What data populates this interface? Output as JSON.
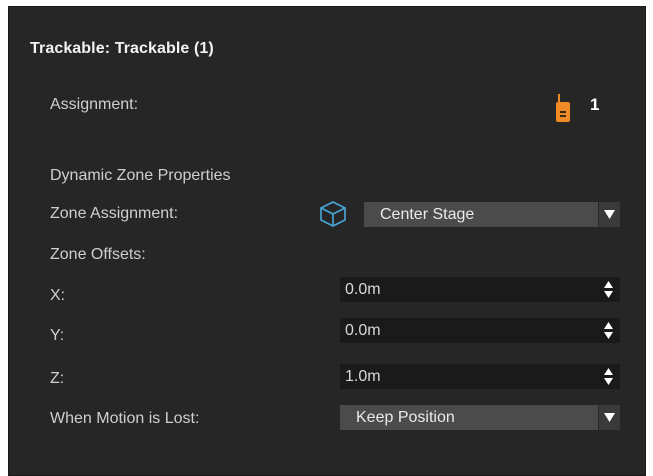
{
  "panel": {
    "title": "Trackable: Trackable (1)"
  },
  "assignment": {
    "label": "Assignment:",
    "value": "1",
    "icon": "handheld-tracker-icon",
    "icon_color": "#f08a24"
  },
  "dynamic_zone": {
    "section_label": "Dynamic Zone Properties",
    "zone_assignment": {
      "label": "Zone Assignment:",
      "icon": "cube-icon",
      "icon_color": "#4aa8d8",
      "selected": "Center Stage"
    },
    "zone_offsets": {
      "label": "Zone Offsets:",
      "x": {
        "label": "X:",
        "value": "0.0m"
      },
      "y": {
        "label": "Y:",
        "value": "0.0m"
      },
      "z": {
        "label": "Z:",
        "value": "1.0m"
      }
    },
    "motion_lost": {
      "label": "When Motion is Lost:",
      "selected": "Keep Position"
    }
  },
  "colors": {
    "panel_bg": "#262626",
    "field_bg": "#1a1a1a",
    "dropdown_bg": "#4b4b4b",
    "text": "#cfcfcf"
  }
}
